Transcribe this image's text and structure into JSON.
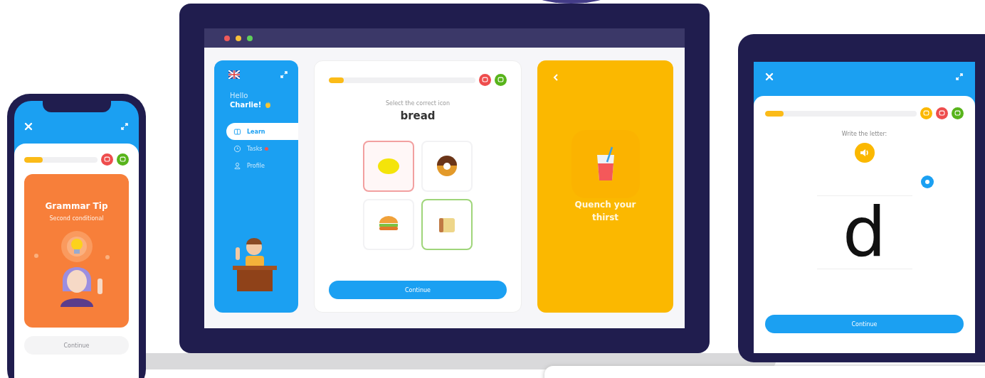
{
  "phone": {
    "progress": {
      "level": 0.25
    },
    "card": {
      "title": "Grammar Tip",
      "subtitle": "Second conditional"
    },
    "button": {
      "label": "Continue",
      "disabled": true
    }
  },
  "laptop": {
    "sidebar": {
      "greeting": "Hello",
      "name": "Charlie!",
      "items": [
        {
          "label": "Learn",
          "kind": "book",
          "selected": true,
          "badge": false
        },
        {
          "label": "Tasks",
          "kind": "clock",
          "selected": false,
          "badge": true
        },
        {
          "label": "Profile",
          "kind": "person",
          "selected": false,
          "badge": false
        }
      ]
    },
    "lesson": {
      "progress": {
        "level": 0.1
      },
      "instruction": "Select the correct icon",
      "word": "bread",
      "options": [
        {
          "kind": "lemon",
          "selected": true,
          "correct": false
        },
        {
          "kind": "donut",
          "selected": false,
          "correct": false
        },
        {
          "kind": "burger",
          "selected": false,
          "correct": false
        },
        {
          "kind": "bread",
          "selected": false,
          "correct": true
        }
      ],
      "button": "Continue"
    },
    "tip": {
      "title": "Quench your thirst"
    }
  },
  "tablet": {
    "progress": {
      "level": 0.12
    },
    "instruction": "Write the letter:",
    "letter": "d",
    "button": "Continue"
  }
}
